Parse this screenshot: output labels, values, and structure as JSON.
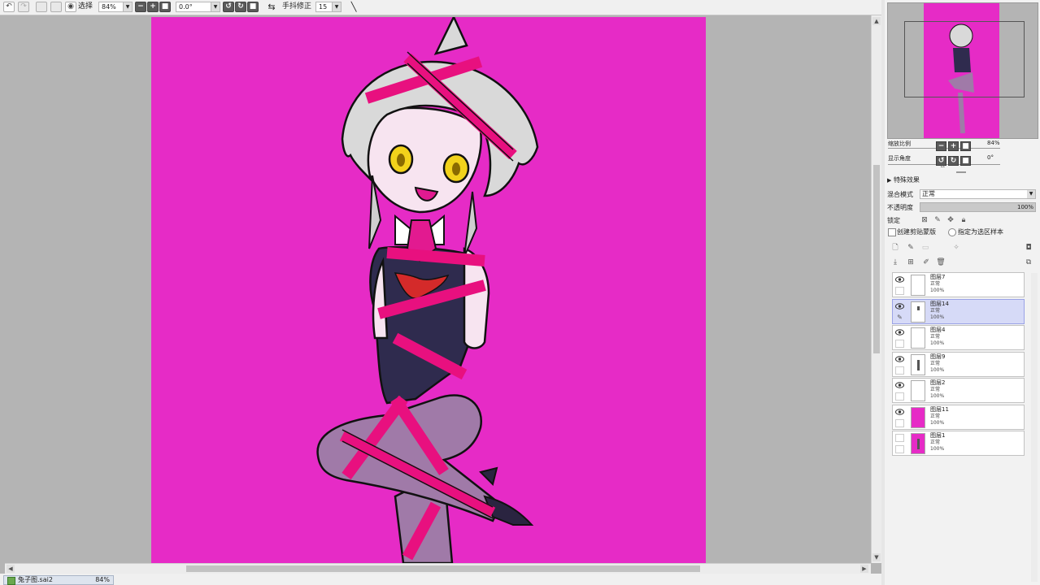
{
  "toolbar": {
    "select_label": "选择",
    "zoom_value": "84%",
    "angle_value": "0.0°",
    "stabilizer_label": "手抖修正",
    "stabilizer_value": "15"
  },
  "navigator": {
    "zoom_label": "缩放比例",
    "zoom_value": "84%",
    "angle_label": "显示角度",
    "angle_value": "0°"
  },
  "properties": {
    "effects_label": "特殊效果",
    "blend_label": "混合模式",
    "blend_value": "正常",
    "opacity_label": "不透明度",
    "opacity_value": "100%",
    "lock_label": "锁定",
    "clip_label": "创建剪贴蒙版",
    "selection_source_label": "指定为选区样本"
  },
  "layers": [
    {
      "name": "图层7",
      "mode": "正常",
      "opacity": "100%",
      "visible": true,
      "selected": false,
      "thumb": "blank"
    },
    {
      "name": "图层14",
      "mode": "正常",
      "opacity": "100%",
      "visible": true,
      "selected": true,
      "thumb": "small-figure"
    },
    {
      "name": "图层4",
      "mode": "正常",
      "opacity": "100%",
      "visible": true,
      "selected": false,
      "thumb": "blank"
    },
    {
      "name": "图层9",
      "mode": "正常",
      "opacity": "100%",
      "visible": true,
      "selected": false,
      "thumb": "figure"
    },
    {
      "name": "图层2",
      "mode": "正常",
      "opacity": "100%",
      "visible": true,
      "selected": false,
      "thumb": "blank"
    },
    {
      "name": "图层11",
      "mode": "正常",
      "opacity": "100%",
      "visible": true,
      "selected": false,
      "thumb": "magenta"
    },
    {
      "name": "图层1",
      "mode": "正常",
      "opacity": "100%",
      "visible": false,
      "selected": false,
      "thumb": "magenta-figure"
    }
  ],
  "status": {
    "document_name": "兔子图.sai2",
    "document_zoom": "84%"
  },
  "colors": {
    "canvas_background": "#e62bc6",
    "selected_layer": "#d6daf7",
    "workspace": "#b4b4b4"
  }
}
